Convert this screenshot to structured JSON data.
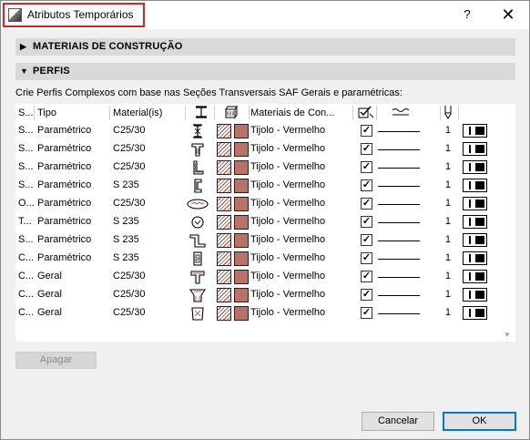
{
  "window": {
    "title": "Atributos Temporários",
    "help_label": "?",
    "close_label": "✕"
  },
  "sections": {
    "materials": {
      "label": "MATERIAIS DE CONSTRUÇÃO",
      "arrow": "▶",
      "expanded": false
    },
    "profiles": {
      "label": "PERFIS",
      "arrow": "▼",
      "expanded": true
    }
  },
  "description": "Crie Perfis Complexos com base nas Seções Transversais SAF Gerais e paramétricas:",
  "table": {
    "headers": {
      "name": "S...",
      "type": "Tipo",
      "material": "Material(is)",
      "shape_icon": "profile-shape-icon",
      "surface_icon": "surface-icon",
      "building_material": "Materiais de Con...",
      "override_icon": "override-check-icon",
      "line_icon": "line-type-icon",
      "pen_icon": "pen-icon"
    },
    "rows": [
      {
        "name": "S...",
        "type": "Paramétrico",
        "material": "C25/30",
        "shape": "i-beam-tapered",
        "building_material": "Tijolo - Vermelho",
        "checked": true,
        "pen": "1"
      },
      {
        "name": "S...",
        "type": "Paramétrico",
        "material": "C25/30",
        "shape": "t-section",
        "building_material": "Tijolo - Vermelho",
        "checked": true,
        "pen": "1"
      },
      {
        "name": "S...",
        "type": "Paramétrico",
        "material": "C25/30",
        "shape": "l-section",
        "building_material": "Tijolo - Vermelho",
        "checked": true,
        "pen": "1"
      },
      {
        "name": "S...",
        "type": "Paramétrico",
        "material": "S 235",
        "shape": "c-channel",
        "building_material": "Tijolo - Vermelho",
        "checked": true,
        "pen": "1"
      },
      {
        "name": "O...",
        "type": "Paramétrico",
        "material": "C25/30",
        "shape": "oval",
        "building_material": "Tijolo - Vermelho",
        "checked": true,
        "pen": "1"
      },
      {
        "name": "T...",
        "type": "Paramétrico",
        "material": "S 235",
        "shape": "circle-tube",
        "building_material": "Tijolo - Vermelho",
        "checked": true,
        "pen": "1"
      },
      {
        "name": "S...",
        "type": "Paramétrico",
        "material": "S 235",
        "shape": "z-section",
        "building_material": "Tijolo - Vermelho",
        "checked": true,
        "pen": "1"
      },
      {
        "name": "C...",
        "type": "Paramétrico",
        "material": "S 235",
        "shape": "box-tube",
        "building_material": "Tijolo - Vermelho",
        "checked": true,
        "pen": "1"
      },
      {
        "name": "C...",
        "type": "Geral",
        "material": "C25/30",
        "shape": "t-general",
        "building_material": "Tijolo - Vermelho",
        "checked": true,
        "pen": "1"
      },
      {
        "name": "C...",
        "type": "Geral",
        "material": "C25/30",
        "shape": "trapezoid-general",
        "building_material": "Tijolo - Vermelho",
        "checked": true,
        "pen": "1"
      },
      {
        "name": "C...",
        "type": "Geral",
        "material": "C25/30",
        "shape": "trapezoid-inner",
        "building_material": "Tijolo - Vermelho",
        "checked": true,
        "pen": "1"
      }
    ]
  },
  "buttons": {
    "delete": "Apagar",
    "cancel": "Cancelar",
    "ok": "OK"
  },
  "colors": {
    "title_highlight": "#e02020",
    "section_header_bg": "#d9d9d9",
    "swatch_fill": "#b87268",
    "hatch_line": "#c0392b",
    "default_button_border": "#0078d7"
  }
}
